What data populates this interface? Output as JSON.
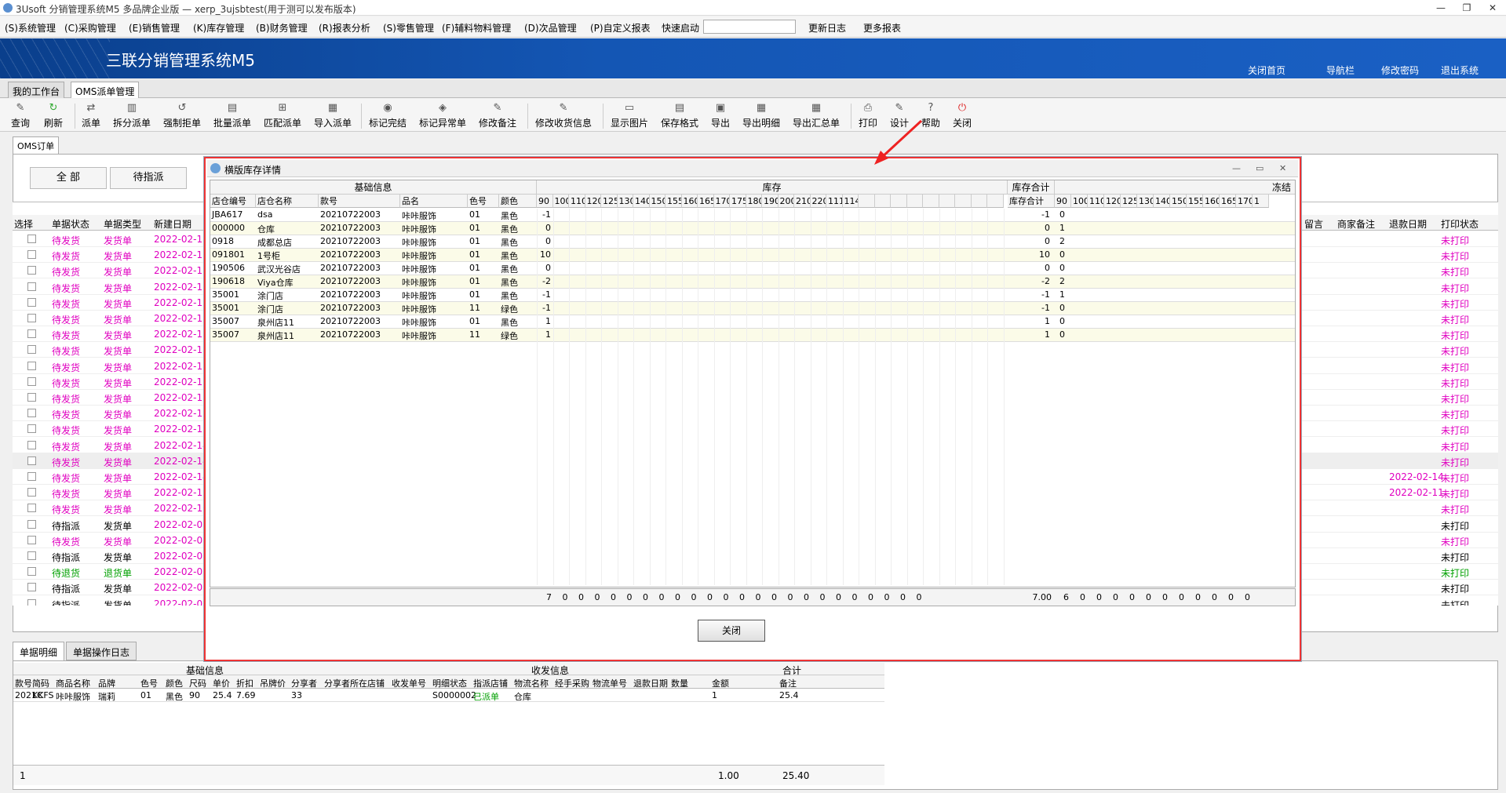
{
  "window": {
    "title": "3Usoft 分销管理系统M5 多品牌企业版 — xerp_3ujsbtest(用于测可以发布版本)"
  },
  "menu": {
    "items": [
      "(S)系统管理",
      "(C)采购管理",
      "(E)销售管理",
      "(K)库存管理",
      "(B)财务管理",
      "(R)报表分析",
      "(S)零售管理",
      "(F)辅料物料管理",
      "(D)次品管理",
      "(P)自定义报表"
    ],
    "quick_label": "快速启动",
    "quick_value": "",
    "update_log": "更新日志",
    "more_reports": "更多报表"
  },
  "banner": {
    "title": "三联分销管理系统M5",
    "links": [
      "关闭首页",
      "导航栏",
      "修改密码",
      "退出系统"
    ]
  },
  "top_tabs": [
    "我的工作台",
    "OMS派单管理"
  ],
  "toolbar": {
    "buttons": [
      "查询",
      "刷新",
      "派单",
      "拆分派单",
      "强制拒单",
      "批量派单",
      "匹配派单",
      "导入派单",
      "标记完结",
      "标记异常单",
      "修改备注",
      "修改收货信息",
      "显示图片",
      "保存格式",
      "导出",
      "导出明细",
      "导出汇总单",
      "打印",
      "设计",
      "帮助",
      "关闭"
    ]
  },
  "main_tab": "OMS订单",
  "filters": [
    "全 部",
    "待指派"
  ],
  "grid": {
    "headers": [
      "选择",
      "单据状态",
      "单据类型",
      "新建日期"
    ],
    "right_headers": [
      "留言",
      "商家备注",
      "退款日期",
      "打印状态"
    ],
    "rows": [
      {
        "status": "待发货",
        "type": "发货单",
        "date": "2022-02-18",
        "refund": "",
        "print": "未打印",
        "cls": "pink"
      },
      {
        "status": "待发货",
        "type": "发货单",
        "date": "2022-02-18",
        "refund": "",
        "print": "未打印",
        "cls": "pink"
      },
      {
        "status": "待发货",
        "type": "发货单",
        "date": "2022-02-18",
        "refund": "",
        "print": "未打印",
        "cls": "pink"
      },
      {
        "status": "待发货",
        "type": "发货单",
        "date": "2022-02-18",
        "refund": "",
        "print": "未打印",
        "cls": "pink"
      },
      {
        "status": "待发货",
        "type": "发货单",
        "date": "2022-02-18",
        "refund": "",
        "print": "未打印",
        "cls": "pink"
      },
      {
        "status": "待发货",
        "type": "发货单",
        "date": "2022-02-18",
        "refund": "",
        "print": "未打印",
        "cls": "pink"
      },
      {
        "status": "待发货",
        "type": "发货单",
        "date": "2022-02-18",
        "refund": "",
        "print": "未打印",
        "cls": "pink"
      },
      {
        "status": "待发货",
        "type": "发货单",
        "date": "2022-02-18",
        "refund": "",
        "print": "未打印",
        "cls": "pink"
      },
      {
        "status": "待发货",
        "type": "发货单",
        "date": "2022-02-18",
        "refund": "",
        "print": "未打印",
        "cls": "pink"
      },
      {
        "status": "待发货",
        "type": "发货单",
        "date": "2022-02-18",
        "refund": "",
        "print": "未打印",
        "cls": "pink"
      },
      {
        "status": "待发货",
        "type": "发货单",
        "date": "2022-02-18",
        "refund": "",
        "print": "未打印",
        "cls": "pink"
      },
      {
        "status": "待发货",
        "type": "发货单",
        "date": "2022-02-17",
        "refund": "",
        "print": "未打印",
        "cls": "pink"
      },
      {
        "status": "待发货",
        "type": "发货单",
        "date": "2022-02-17",
        "refund": "",
        "print": "未打印",
        "cls": "pink"
      },
      {
        "status": "待发货",
        "type": "发货单",
        "date": "2022-02-14",
        "refund": "",
        "print": "未打印",
        "cls": "pink"
      },
      {
        "status": "待发货",
        "type": "发货单",
        "date": "2022-02-14",
        "refund": "",
        "print": "未打印",
        "cls": "pink"
      },
      {
        "status": "待发货",
        "type": "发货单",
        "date": "2022-02-14",
        "refund": "2022-02-14",
        "print": "未打印",
        "cls": "pink"
      },
      {
        "status": "待发货",
        "type": "发货单",
        "date": "2022-02-11",
        "refund": "2022-02-11",
        "print": "未打印",
        "cls": "pink"
      },
      {
        "status": "待发货",
        "type": "发货单",
        "date": "2022-02-10",
        "refund": "",
        "print": "未打印",
        "cls": "pink"
      },
      {
        "status": "待指派",
        "type": "发货单",
        "date": "2022-02-08",
        "refund": "",
        "print": "未打印",
        "cls": ""
      },
      {
        "status": "待发货",
        "type": "发货单",
        "date": "2022-02-08",
        "refund": "",
        "print": "未打印",
        "cls": "pink"
      },
      {
        "status": "待指派",
        "type": "发货单",
        "date": "2022-02-08",
        "refund": "",
        "print": "未打印",
        "cls": ""
      },
      {
        "status": "待退货",
        "type": "退货单",
        "date": "2022-02-08",
        "refund": "",
        "print": "未打印",
        "cls": "green"
      },
      {
        "status": "待指派",
        "type": "发货单",
        "date": "2022-02-08",
        "refund": "",
        "print": "未打印",
        "cls": ""
      },
      {
        "status": "待指派",
        "type": "发货单",
        "date": "2022-02-08",
        "refund": "",
        "print": "未打印",
        "cls": ""
      }
    ]
  },
  "bottom_tabs": [
    "单据明细",
    "单据操作日志"
  ],
  "detail": {
    "group_headers": [
      "基础信息",
      "收发信息",
      "合计"
    ],
    "headers": [
      "款号",
      "简码",
      "商品名称",
      "品牌",
      "色号",
      "颜色",
      "尺码",
      "单价",
      "折扣",
      "吊牌价",
      "分享者",
      "分享者所在店铺",
      "收发单号",
      "明细状态",
      "指派店铺",
      "物流名称",
      "经手采购",
      "物流单号",
      "退款日期",
      "数量",
      "金额",
      "备注"
    ],
    "row": [
      "2021C",
      "KKFS",
      "咔咔服饰",
      "瑞莉",
      "01",
      "黑色",
      "90",
      "25.4",
      "7.69",
      "",
      "33",
      "",
      "",
      "S0000002",
      "已派单",
      "仓库",
      "",
      "",
      "",
      "",
      "1",
      "25.4",
      ""
    ],
    "footer": {
      "count": "1",
      "qty": "1.00",
      "amount": "25.40"
    }
  },
  "dialog": {
    "title": "横版库存详情",
    "groups": [
      "基础信息",
      "库存",
      "库存合计",
      "冻结"
    ],
    "base_headers": [
      "店仓编号",
      "店仓名称",
      "款号",
      "品名",
      "色号",
      "颜色"
    ],
    "sizes": [
      "90",
      "100",
      "110",
      "120",
      "125",
      "130",
      "140",
      "150",
      "155",
      "160",
      "165",
      "170",
      "175",
      "180",
      "190",
      "200",
      "210",
      "220",
      "111",
      "114"
    ],
    "total_header": "库存合计",
    "frozen_sizes": [
      "90",
      "100",
      "110",
      "120",
      "125",
      "130",
      "140",
      "150",
      "155",
      "160",
      "165",
      "170",
      "1"
    ],
    "rows": [
      {
        "code": "JBA617",
        "name": "dsa",
        "style": "20210722003",
        "item": "咔咔服饰",
        "color_no": "01",
        "color": "黑色",
        "s90": "-1",
        "total": "-1",
        "f90": "0"
      },
      {
        "code": "000000",
        "name": "仓库",
        "style": "20210722003",
        "item": "咔咔服饰",
        "color_no": "01",
        "color": "黑色",
        "s90": "0",
        "total": "0",
        "f90": "1"
      },
      {
        "code": "0918",
        "name": "成都总店",
        "style": "20210722003",
        "item": "咔咔服饰",
        "color_no": "01",
        "color": "黑色",
        "s90": "0",
        "total": "0",
        "f90": "2"
      },
      {
        "code": "091801",
        "name": "1号柜",
        "style": "20210722003",
        "item": "咔咔服饰",
        "color_no": "01",
        "color": "黑色",
        "s90": "10",
        "total": "10",
        "f90": "0"
      },
      {
        "code": "190506",
        "name": "武汉光谷店",
        "style": "20210722003",
        "item": "咔咔服饰",
        "color_no": "01",
        "color": "黑色",
        "s90": "0",
        "total": "0",
        "f90": "0"
      },
      {
        "code": "190618",
        "name": "Viya仓库",
        "style": "20210722003",
        "item": "咔咔服饰",
        "color_no": "01",
        "color": "黑色",
        "s90": "-2",
        "total": "-2",
        "f90": "2"
      },
      {
        "code": "35001",
        "name": "涂门店",
        "style": "20210722003",
        "item": "咔咔服饰",
        "color_no": "01",
        "color": "黑色",
        "s90": "-1",
        "total": "-1",
        "f90": "1"
      },
      {
        "code": "35001",
        "name": "涂门店",
        "style": "20210722003",
        "item": "咔咔服饰",
        "color_no": "11",
        "color": "绿色",
        "s90": "-1",
        "total": "-1",
        "f90": "0"
      },
      {
        "code": "35007",
        "name": "泉州店11",
        "style": "20210722003",
        "item": "咔咔服饰",
        "color_no": "01",
        "color": "黑色",
        "s90": "1",
        "total": "1",
        "f90": "0"
      },
      {
        "code": "35007",
        "name": "泉州店11",
        "style": "20210722003",
        "item": "咔咔服饰",
        "color_no": "11",
        "color": "绿色",
        "s90": "1",
        "total": "1",
        "f90": "0"
      }
    ],
    "footer": {
      "s90": "7",
      "total": "7.00",
      "f90": "6"
    },
    "close_label": "关闭"
  }
}
